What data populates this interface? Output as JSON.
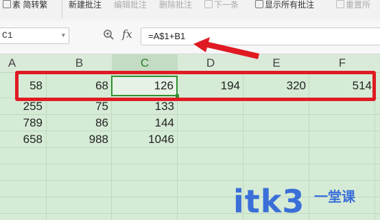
{
  "ribbon": {
    "items": [
      {
        "label": "素 简转繁",
        "disabled": false
      },
      {
        "label": "新建批注",
        "disabled": false
      },
      {
        "label": "编辑批注",
        "disabled": true
      },
      {
        "label": "删除批注",
        "disabled": true
      },
      {
        "label": "下一条",
        "disabled": true
      },
      {
        "label": "显示所有批注",
        "disabled": false
      },
      {
        "label": "重置所",
        "disabled": true
      }
    ]
  },
  "formula_bar": {
    "name_box": "C1",
    "fx_symbol": "fx",
    "formula": "=A$1+B1"
  },
  "columns": [
    "A",
    "B",
    "C",
    "D",
    "E",
    "F"
  ],
  "selected_column": "C",
  "rows": [
    [
      "58",
      "68",
      "126",
      "194",
      "320",
      "514"
    ],
    [
      "255",
      "75",
      "133",
      "",
      "",
      ""
    ],
    [
      "789",
      "86",
      "144",
      "",
      "",
      ""
    ],
    [
      "658",
      "988",
      "1046",
      "",
      "",
      ""
    ]
  ],
  "active_cell": "C1",
  "annotation_colors": {
    "highlight": "#e01a22",
    "selection": "#2f8f2f"
  },
  "watermark": {
    "text": "itk3",
    "cn": "一堂课"
  }
}
